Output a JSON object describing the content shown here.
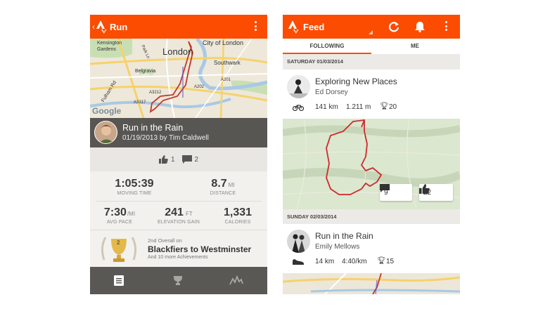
{
  "left": {
    "header_title": "Run",
    "map_labels": {
      "kensington_gardens": "Kensington\nGardens",
      "london": "London",
      "city_of_london": "City of London",
      "southwark": "Southwark",
      "belgravia": "Belgravia",
      "fulham_rd": "Fulham Rd",
      "a3212": "A3212",
      "a202": "A202",
      "a201": "A201",
      "a3217": "A3217",
      "park_ln": "Park Ln",
      "google": "Google"
    },
    "activity": {
      "title": "Run in the Rain",
      "subtitle": "01/19/2013 by Tim Caldwell"
    },
    "kudos_count": "1",
    "comment_count": "2",
    "stats": {
      "moving_time": {
        "value": "1:05:39",
        "label": "MOVING TIME"
      },
      "distance": {
        "value": "8.7",
        "unit": "MI",
        "label": "DISTANCE"
      },
      "avg_pace": {
        "value": "7:30",
        "unit": "/MI",
        "label": "AVG PACE"
      },
      "elevation_gain": {
        "value": "241",
        "unit": "FT",
        "label": "ELEVATION GAIN"
      },
      "calories": {
        "value": "1,331",
        "label": "CALORIES"
      }
    },
    "achievement": {
      "rank": "2",
      "overline": "2nd Overall on",
      "title": "Blackfiers to Westminster",
      "note": "And 10 more Achievements"
    }
  },
  "right": {
    "header_title": "Feed",
    "tabs": [
      "FOLLOWING",
      "ME"
    ],
    "sections": [
      {
        "date": "SATURDAY 01/03/2014",
        "title": "Exploring New Places",
        "athlete": "Ed Dorsey",
        "distance": "141 km",
        "elevation": "1.211 m",
        "trophies": "20",
        "comments": "9",
        "kudos": "22"
      },
      {
        "date": "SUNDAY 02/03/2014",
        "title": "Run in the Rain",
        "athlete": "Emily Mellows",
        "distance": "14 km",
        "pace": "4:40/km",
        "trophies": "15"
      }
    ]
  },
  "colors": {
    "brand_orange": "#fc4c02",
    "header_gray": "#585653",
    "route_red": "#d42b2b"
  }
}
